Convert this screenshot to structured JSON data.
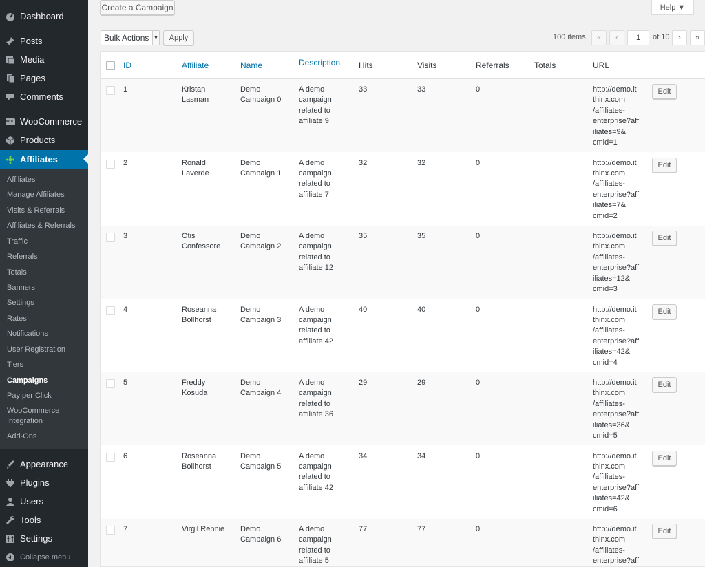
{
  "sidebar": {
    "top_menu": [
      {
        "label": "Dashboard",
        "icon": "dashboard-icon"
      },
      {
        "label": "Posts",
        "icon": "pin-icon"
      },
      {
        "label": "Media",
        "icon": "media-icon"
      },
      {
        "label": "Pages",
        "icon": "pages-icon"
      },
      {
        "label": "Comments",
        "icon": "comments-icon"
      },
      {
        "label": "WooCommerce",
        "icon": "woocommerce-icon",
        "icon_text": "WOO"
      },
      {
        "label": "Products",
        "icon": "products-icon"
      },
      {
        "label": "Affiliates",
        "icon": "affiliates-icon",
        "active": true
      }
    ],
    "submenu": [
      "Affiliates",
      "Manage Affiliates",
      "Visits & Referrals",
      "Affiliates & Referrals",
      "Traffic",
      "Referrals",
      "Totals",
      "Banners",
      "Settings",
      "Rates",
      "Notifications",
      "User Registration",
      "Tiers",
      "Campaigns",
      "Pay per Click",
      "WooCommerce Integration",
      "Add-Ons"
    ],
    "current_submenu": "Campaigns",
    "bottom_menu": [
      {
        "label": "Appearance",
        "icon": "appearance-icon"
      },
      {
        "label": "Plugins",
        "icon": "plugins-icon"
      },
      {
        "label": "Users",
        "icon": "users-icon"
      },
      {
        "label": "Tools",
        "icon": "tools-icon"
      },
      {
        "label": "Settings",
        "icon": "settings-icon"
      }
    ],
    "collapse_label": "Collapse menu"
  },
  "header": {
    "create_button": "Create a Campaign",
    "help_tab": "Help ▼"
  },
  "toolbar": {
    "bulk_actions": "Bulk Actions",
    "apply": "Apply",
    "items_count": "100 items",
    "page_first": "«",
    "page_prev": "‹",
    "current_page": "1",
    "page_of": "of 10",
    "page_next": "›",
    "page_last": "»"
  },
  "table": {
    "columns": [
      "ID",
      "Affiliate",
      "Name",
      "Description",
      "Hits",
      "Visits",
      "Referrals",
      "Totals",
      "URL"
    ],
    "edit_label": "Edit",
    "rows": [
      {
        "id": "1",
        "affiliate": "Kristan\nLasman",
        "name": "Demo\nCampaign 0",
        "description": "A demo\ncampaign\nrelated to\naffiliate 9",
        "hits": "33",
        "visits": "33",
        "referrals": "0",
        "totals": "",
        "url": "http://demo.it\nthinx.com\n/affiliates-\nenterprise?aff\niliates=9&\ncmid=1"
      },
      {
        "id": "2",
        "affiliate": "Ronald\nLaverde",
        "name": "Demo\nCampaign 1",
        "description": "A demo\ncampaign\nrelated to\naffiliate 7",
        "hits": "32",
        "visits": "32",
        "referrals": "0",
        "totals": "",
        "url": "http://demo.it\nthinx.com\n/affiliates-\nenterprise?aff\niliates=7&\ncmid=2"
      },
      {
        "id": "3",
        "affiliate": "Otis\nConfessore",
        "name": "Demo\nCampaign 2",
        "description": "A demo\ncampaign\nrelated to\naffiliate 12",
        "hits": "35",
        "visits": "35",
        "referrals": "0",
        "totals": "",
        "url": "http://demo.it\nthinx.com\n/affiliates-\nenterprise?aff\niliates=12&\ncmid=3"
      },
      {
        "id": "4",
        "affiliate": "Roseanna\nBollhorst",
        "name": "Demo\nCampaign 3",
        "description": "A demo\ncampaign\nrelated to\naffiliate 42",
        "hits": "40",
        "visits": "40",
        "referrals": "0",
        "totals": "",
        "url": "http://demo.it\nthinx.com\n/affiliates-\nenterprise?aff\niliates=42&\ncmid=4"
      },
      {
        "id": "5",
        "affiliate": "Freddy\nKosuda",
        "name": "Demo\nCampaign 4",
        "description": "A demo\ncampaign\nrelated to\naffiliate 36",
        "hits": "29",
        "visits": "29",
        "referrals": "0",
        "totals": "",
        "url": "http://demo.it\nthinx.com\n/affiliates-\nenterprise?aff\niliates=36&\ncmid=5"
      },
      {
        "id": "6",
        "affiliate": "Roseanna\nBollhorst",
        "name": "Demo\nCampaign 5",
        "description": "A demo\ncampaign\nrelated to\naffiliate 42",
        "hits": "34",
        "visits": "34",
        "referrals": "0",
        "totals": "",
        "url": "http://demo.it\nthinx.com\n/affiliates-\nenterprise?aff\niliates=42&\ncmid=6"
      },
      {
        "id": "7",
        "affiliate": "Virgil Rennie",
        "name": "Demo\nCampaign 6",
        "description": "A demo\ncampaign\nrelated to\naffiliate 5",
        "hits": "77",
        "visits": "77",
        "referrals": "0",
        "totals": "",
        "url": "http://demo.it\nthinx.com\n/affiliates-\nenterprise?aff"
      }
    ]
  },
  "colors": {
    "sidebar_bg": "#23282d",
    "submenu_bg": "#32373c",
    "active_blue": "#0073aa",
    "page_bg": "#f1f1f1"
  }
}
